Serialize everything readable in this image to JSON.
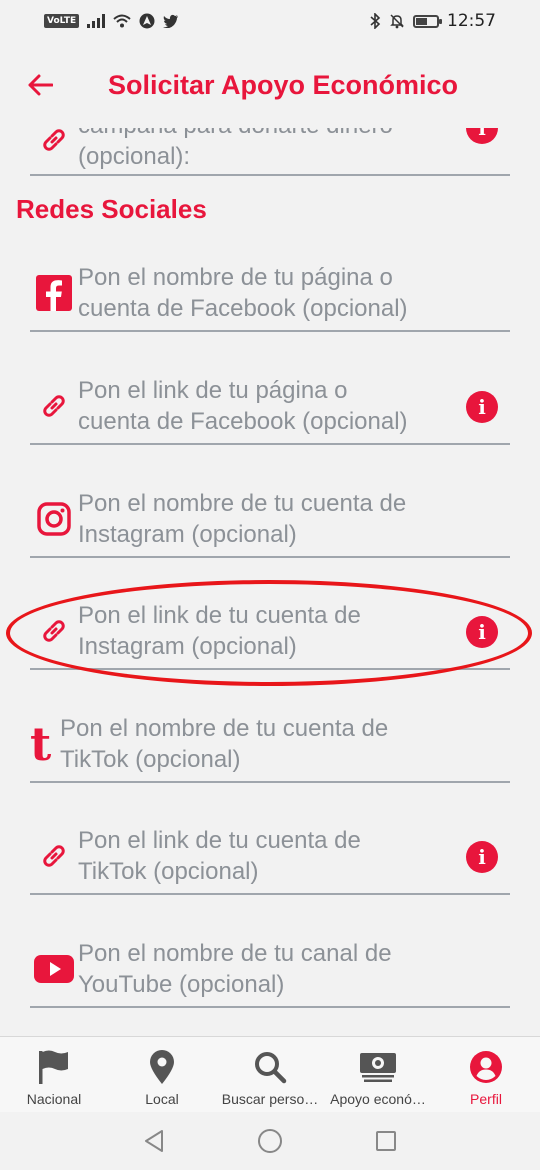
{
  "status_bar": {
    "network_badge": "VoLTE",
    "time": "12:57",
    "battery_level": 0.55
  },
  "header": {
    "title": "Solicitar Apoyo Económico"
  },
  "partial_field": {
    "line1": "campaña para donarte dinero",
    "line2": "(opcional):"
  },
  "section": {
    "title": "Redes Sociales"
  },
  "fields": [
    {
      "icon": "facebook-icon",
      "line1": "Pon el nombre de tu página o",
      "line2": "cuenta de Facebook (opcional)",
      "has_info": false
    },
    {
      "icon": "link-icon",
      "line1": "Pon el link de tu página o",
      "line2": "cuenta de Facebook (opcional)",
      "has_info": true
    },
    {
      "icon": "instagram-icon",
      "line1": "Pon el nombre de tu cuenta de",
      "line2": "Instagram (opcional)",
      "has_info": false
    },
    {
      "icon": "link-icon",
      "line1": "Pon el link de tu cuenta de",
      "line2": "Instagram (opcional)",
      "has_info": true
    },
    {
      "icon": "tiktok-icon",
      "line1": "Pon el nombre de tu cuenta de",
      "line2": "TikTok (opcional)",
      "has_info": false
    },
    {
      "icon": "link-icon",
      "line1": "Pon el link de tu cuenta de",
      "line2": "TikTok (opcional)",
      "has_info": true
    },
    {
      "icon": "youtube-icon",
      "line1": "Pon el nombre de tu canal de",
      "line2": "YouTube (opcional)",
      "has_info": false
    }
  ],
  "info_symbol": "i",
  "tiktok_glyph": "t",
  "bottom_nav": [
    {
      "label": "Nacional",
      "icon": "flag-icon",
      "active": false
    },
    {
      "label": "Local",
      "icon": "map-pin-icon",
      "active": false
    },
    {
      "label": "Buscar perso…",
      "icon": "search-icon",
      "active": false
    },
    {
      "label": "Apoyo econó…",
      "icon": "money-icon",
      "active": false
    },
    {
      "label": "Perfil",
      "icon": "user-icon",
      "active": true
    }
  ],
  "colors": {
    "accent": "#e8163c",
    "placeholder": "#8c9197",
    "underline": "#a0a6ad",
    "highlight_ring": "#e8161a"
  }
}
